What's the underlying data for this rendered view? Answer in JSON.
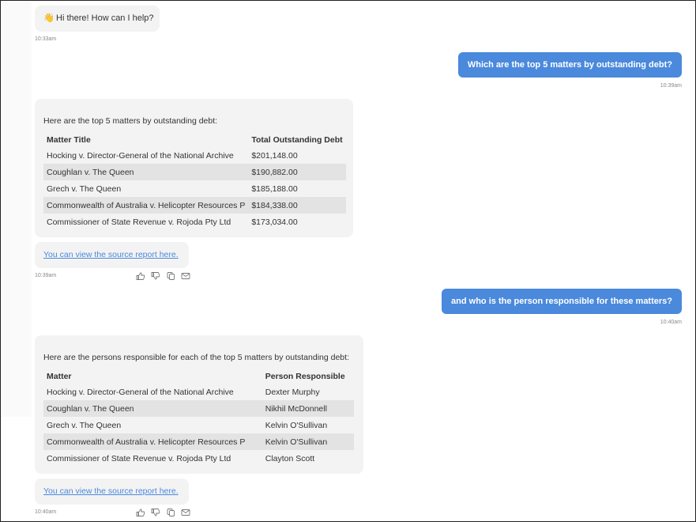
{
  "greeting": {
    "emoji": "👋",
    "text": "Hi there! How can I help?",
    "time": "10:33am"
  },
  "user_q1": {
    "text": "Which are the top 5 matters by outstanding debt?",
    "time": "10:39am"
  },
  "bot_a1": {
    "intro": "Here are the top 5 matters by outstanding debt:",
    "headers": [
      "Matter Title",
      "Total Outstanding Debt"
    ],
    "rows": [
      [
        "Hocking v. Director-General of the National Archive",
        "$201,148.00"
      ],
      [
        "Coughlan v. The Queen",
        "$190,882.00"
      ],
      [
        "Grech v. The Queen",
        "$185,188.00"
      ],
      [
        "Commonwealth of Australia v. Helicopter Resources P",
        "$184,338.00"
      ],
      [
        "Commissioner of State Revenue v. Rojoda Pty Ltd",
        "$173,034.00"
      ]
    ],
    "link": "You can view the source report here.",
    "time": "10:39am"
  },
  "user_q2": {
    "text": "and who is the person responsible for these matters?",
    "time": "10:40am"
  },
  "bot_a2": {
    "intro": "Here are the persons responsible for each of the top 5 matters by outstanding debt:",
    "headers": [
      "Matter",
      "Person Responsible"
    ],
    "rows": [
      [
        "Hocking v. Director-General of the National Archive",
        "Dexter Murphy"
      ],
      [
        "Coughlan v. The Queen",
        "Nikhil McDonnell"
      ],
      [
        "Grech v. The Queen",
        "Kelvin O'Sullivan"
      ],
      [
        "Commonwealth of Australia v. Helicopter Resources P",
        "Kelvin O'Sullivan"
      ],
      [
        "Commissioner of State Revenue v. Rojoda Pty Ltd",
        "Clayton Scott"
      ]
    ],
    "link": "You can view the source report here.",
    "time": "10:40am"
  },
  "action_icons": [
    "thumbs-up-icon",
    "thumbs-down-icon",
    "copy-icon",
    "email-icon"
  ],
  "colors": {
    "user_bubble": "#4a89dc",
    "bot_bubble": "#f3f3f3",
    "row_shade": "#e3e3e3",
    "link": "#4a89dc"
  }
}
